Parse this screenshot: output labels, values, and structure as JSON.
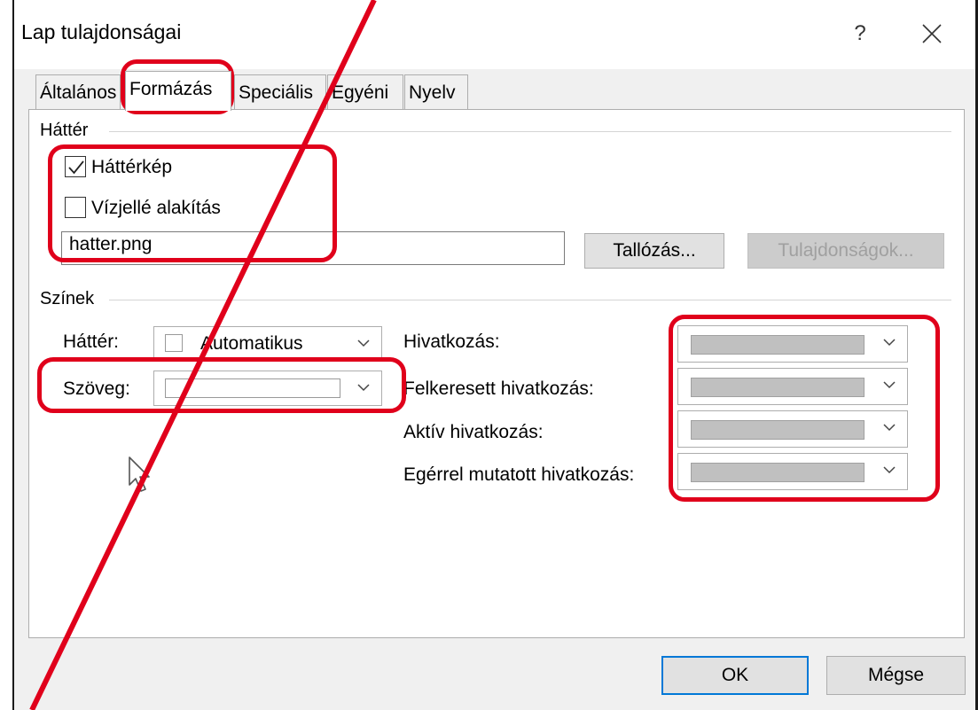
{
  "window": {
    "title": "Lap tulajdonságai",
    "help": "?"
  },
  "tabs": [
    "Általános",
    "Formázás",
    "Speciális",
    "Egyéni",
    "Nyelv"
  ],
  "background_group": {
    "label": "Háttér",
    "background_image": {
      "label": "Háttérkép",
      "checked": true
    },
    "watermark": {
      "label": "Vízjellé alakítás",
      "checked": false
    },
    "file_value": "hatter.png",
    "browse_label": "Tallózás...",
    "properties_label": "Tulajdonságok..."
  },
  "colors_group": {
    "label": "Színek",
    "background_label": "Háttér:",
    "background_value": "Automatikus",
    "text_label": "Szöveg:",
    "link_label": "Hivatkozás:",
    "visited_link_label": "Felkeresett hivatkozás:",
    "active_link_label": "Aktív hivatkozás:",
    "hover_link_label": "Egérrel mutatott hivatkozás:"
  },
  "footer": {
    "ok_label": "OK",
    "cancel_label": "Mégse"
  },
  "annotation_color": "#e0001b"
}
